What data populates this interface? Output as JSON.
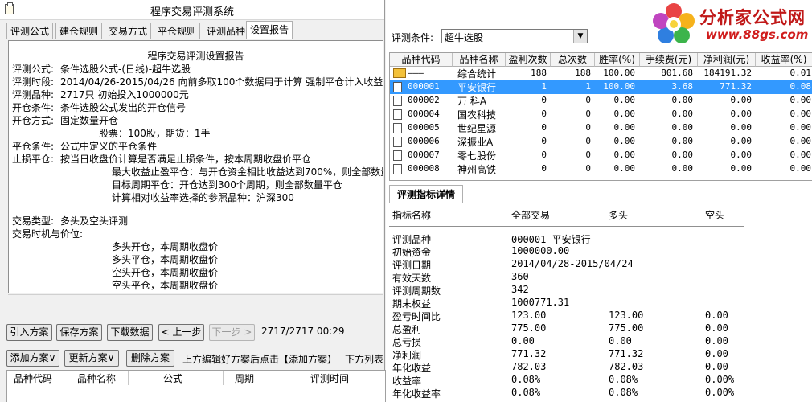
{
  "app": {
    "title": "程序交易评测系统"
  },
  "tabs": [
    "评测公式",
    "建仓规则",
    "交易方式",
    "平仓规则",
    "评测品种",
    "设置报告"
  ],
  "report": {
    "title": "程序交易评测设置报告",
    "lines": [
      {
        "label": "评测公式:",
        "text": "条件选股公式-(日线)-超牛选股"
      },
      {
        "label": "评测时段:",
        "text": "2014/04/26-2015/04/26 向前多取100个数据用于计算 强制平仓计入收益"
      },
      {
        "label": "评测品种:",
        "text": "2717只 初始投入1000000元"
      },
      {
        "label": "开仓条件:",
        "text": "条件选股公式发出的开仓信号"
      },
      {
        "label": "开仓方式:",
        "text": "固定数量开仓"
      },
      {
        "label": "",
        "text": "股票：100股，期货：1手"
      },
      {
        "label": "平仓条件:",
        "text": "公式中定义的平仓条件"
      },
      {
        "label": "止损平仓:",
        "text": "按当日收盘价计算是否满足止损条件，按本周期收盘价平仓"
      },
      {
        "label": "",
        "text": "最大收益止盈平仓：与开仓资金相比收益达到700%，则全部数量平仓"
      },
      {
        "label": "",
        "text": "目标周期平仓：开仓达到300个周期，则全部数量平仓"
      },
      {
        "label": "",
        "text": "计算相对收益率选择的参照品种：沪深300"
      },
      {
        "label": "交易类型:",
        "text": "多头及空头评测"
      },
      {
        "label": "交易时机与价位:",
        "text": ""
      },
      {
        "label": "",
        "text": "多头开仓，本周期收盘价"
      },
      {
        "label": "",
        "text": "多头平仓，本周期收盘价"
      },
      {
        "label": "",
        "text": "空头开仓，本周期收盘价"
      },
      {
        "label": "",
        "text": "空头平仓，本周期收盘价"
      }
    ]
  },
  "toolbar": {
    "import": "引入方案",
    "save": "保存方案",
    "download": "下载数据",
    "prev": "上一步",
    "next": "下一步",
    "status": "2717/2717 00:29"
  },
  "plan": {
    "add": "添加方案∨",
    "update": "更新方案∨",
    "delete": "删除方案",
    "hint": "上方编辑好方案后点击【添加方案】",
    "hint2": "下方列表"
  },
  "plan_list": {
    "columns": [
      "品种代码",
      "品种名称",
      "公式",
      "周期",
      "评测时间"
    ]
  },
  "condition": {
    "label": "评测条件:",
    "value": "超牛选股"
  },
  "logo": {
    "text": "分析家公式网",
    "url": "www.88gs.com"
  },
  "grid": {
    "columns": [
      "品种代码",
      "品种名称",
      "盈利次数",
      "总次数",
      "胜率(%)",
      "手续费(元)",
      "净利润(元)",
      "收益率(%)"
    ],
    "rows": [
      {
        "code": "———",
        "name": "综合统计",
        "win": "188",
        "total": "188",
        "rate": "100.00",
        "fee": "801.68",
        "profit": "184191.32",
        "ret": "0.01"
      },
      {
        "code": "000001",
        "name": "平安银行",
        "win": "1",
        "total": "1",
        "rate": "100.00",
        "fee": "3.68",
        "profit": "771.32",
        "ret": "0.08"
      },
      {
        "code": "000002",
        "name": "万  科A",
        "win": "0",
        "total": "0",
        "rate": "0.00",
        "fee": "0.00",
        "profit": "0.00",
        "ret": "0.00"
      },
      {
        "code": "000004",
        "name": "国农科技",
        "win": "0",
        "total": "0",
        "rate": "0.00",
        "fee": "0.00",
        "profit": "0.00",
        "ret": "0.00"
      },
      {
        "code": "000005",
        "name": "世纪星源",
        "win": "0",
        "total": "0",
        "rate": "0.00",
        "fee": "0.00",
        "profit": "0.00",
        "ret": "0.00"
      },
      {
        "code": "000006",
        "name": "深振业A",
        "win": "0",
        "total": "0",
        "rate": "0.00",
        "fee": "0.00",
        "profit": "0.00",
        "ret": "0.00"
      },
      {
        "code": "000007",
        "name": "零七股份",
        "win": "0",
        "total": "0",
        "rate": "0.00",
        "fee": "0.00",
        "profit": "0.00",
        "ret": "0.00"
      },
      {
        "code": "000008",
        "name": "神州高铁",
        "win": "0",
        "total": "0",
        "rate": "0.00",
        "fee": "0.00",
        "profit": "0.00",
        "ret": "0.00"
      }
    ]
  },
  "detail": {
    "tab": "评测指标详情",
    "headers": [
      "指标名称",
      "全部交易",
      "多头",
      "空头"
    ],
    "rows": [
      [
        "评测品种",
        "000001-平安银行",
        "",
        ""
      ],
      [
        "初始资金",
        "1000000.00",
        "",
        ""
      ],
      [
        "评测日期",
        "2014/04/28-2015/04/24",
        "",
        ""
      ],
      [
        "有效天数",
        "360",
        "",
        ""
      ],
      [
        "评测周期数",
        "342",
        "",
        ""
      ],
      [
        "期末权益",
        "1000771.31",
        "",
        ""
      ],
      [
        "盈亏时间比",
        "123.00",
        "123.00",
        "0.00"
      ],
      [
        "总盈利",
        "775.00",
        "775.00",
        "0.00"
      ],
      [
        "总亏损",
        "0.00",
        "0.00",
        "0.00"
      ],
      [
        "净利润",
        "771.32",
        "771.32",
        "0.00"
      ],
      [
        "年化收益",
        "782.03",
        "782.03",
        "0.00"
      ],
      [
        "收益率",
        "0.08%",
        "0.08%",
        "0.00%"
      ],
      [
        "年化收益率",
        "0.08%",
        "0.08%",
        "0.00%"
      ]
    ]
  },
  "colors": {
    "selection": "#3399ff",
    "logo_red": "#c01818"
  }
}
